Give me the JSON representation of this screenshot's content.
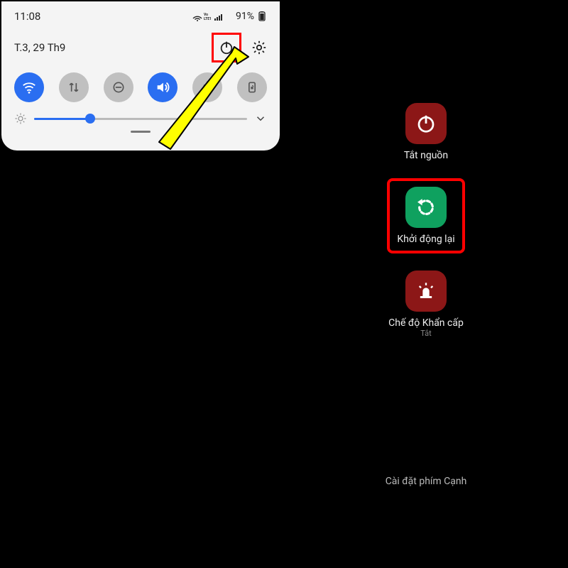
{
  "status": {
    "time": "11:08",
    "battery": "91%"
  },
  "panel": {
    "date": "T.3, 29 Th9",
    "qs": {
      "wifi": true,
      "data": false,
      "dnd": false,
      "sound": true,
      "bt": false,
      "rotation": false
    },
    "brightness_pct": 26
  },
  "icons": {
    "power": "power-icon",
    "gear": "gear-icon",
    "wifi": "wifi-icon",
    "data": "data-icon",
    "dnd": "dnd-icon",
    "sound": "sound-icon",
    "bt": "bluetooth-icon",
    "rotation": "rotation-lock-icon",
    "sun": "brightness-icon",
    "chevron": "chevron-down-icon",
    "restart": "restart-icon",
    "emergency": "emergency-icon"
  },
  "colors": {
    "accent": "#2a6ef1",
    "highlight": "#ff0000",
    "power_off_btn": "#8c1717",
    "restart_btn": "#0fa15f"
  },
  "power_menu": {
    "power_off": {
      "label": "Tắt nguồn"
    },
    "restart": {
      "label": "Khởi động lại"
    },
    "emergency": {
      "label": "Chế độ Khẩn cấp",
      "sub": "Tắt"
    },
    "edge_settings": "Cài đặt phím Cạnh"
  }
}
